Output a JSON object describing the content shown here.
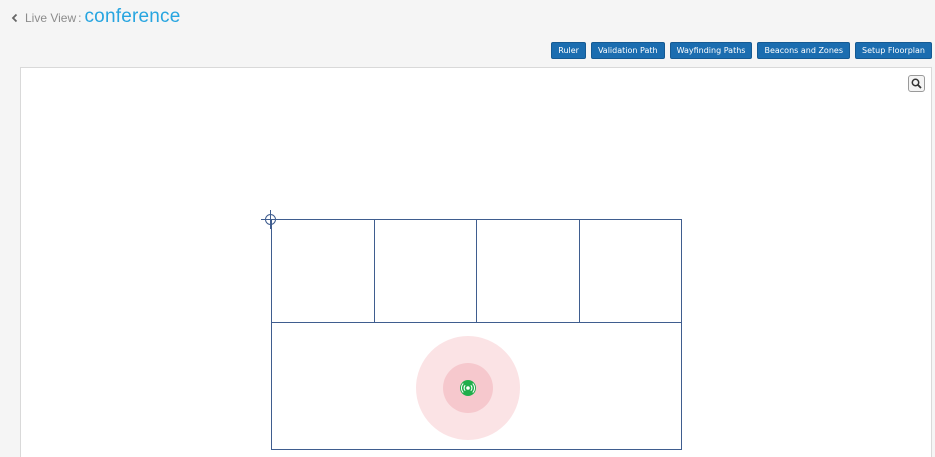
{
  "header": {
    "back_label": "Live View",
    "separator": ":",
    "title": "conference"
  },
  "toolbar": {
    "buttons": [
      {
        "label": "Ruler"
      },
      {
        "label": "Validation Path"
      },
      {
        "label": "Wayfinding Paths"
      },
      {
        "label": "Beacons and Zones"
      },
      {
        "label": "Setup Floorplan"
      }
    ]
  },
  "colors": {
    "accent_title": "#27a5e0",
    "button_bg": "#1b6db0",
    "floorplan_line": "#3f5d8f",
    "beacon_outer": "#fbe3e5",
    "beacon_inner": "#f6c8cd",
    "beacon_icon": "#1fae4b"
  },
  "icons": {
    "back": "chevron-left-icon",
    "zoom": "search-icon",
    "origin": "crosshair-icon",
    "beacon": "beacon-signal-icon"
  }
}
